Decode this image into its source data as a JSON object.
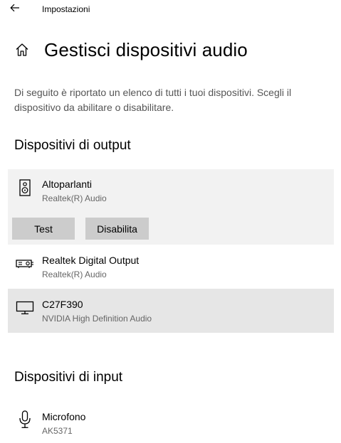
{
  "window": {
    "title": "Impostazioni"
  },
  "page": {
    "title": "Gestisci dispositivi audio",
    "description": "Di seguito è riportato un elenco di tutti i tuoi dispositivi. Scegli il dispositivo da abilitare o disabilitare."
  },
  "output": {
    "heading": "Dispositivi di output",
    "devices": [
      {
        "name": "Altoparlanti",
        "driver": "Realtek(R) Audio",
        "icon": "speaker-icon",
        "state": "selected"
      },
      {
        "name": "Realtek Digital Output",
        "driver": "Realtek(R) Audio",
        "icon": "digital-output-icon",
        "state": "normal"
      },
      {
        "name": "C27F390",
        "driver": "NVIDIA High Definition Audio",
        "icon": "monitor-icon",
        "state": "hover"
      }
    ],
    "buttons": {
      "test_label": "Test",
      "disable_label": "Disabilita"
    }
  },
  "input": {
    "heading": "Dispositivi di input",
    "devices": [
      {
        "name": "Microfono",
        "driver": "AK5371",
        "icon": "microphone-icon",
        "state": "normal"
      }
    ]
  },
  "colors": {
    "selected_bg": "#f2f2f2",
    "hover_bg": "#e6e6e6",
    "button_bg": "#cccccc",
    "secondary_text": "#666666"
  }
}
